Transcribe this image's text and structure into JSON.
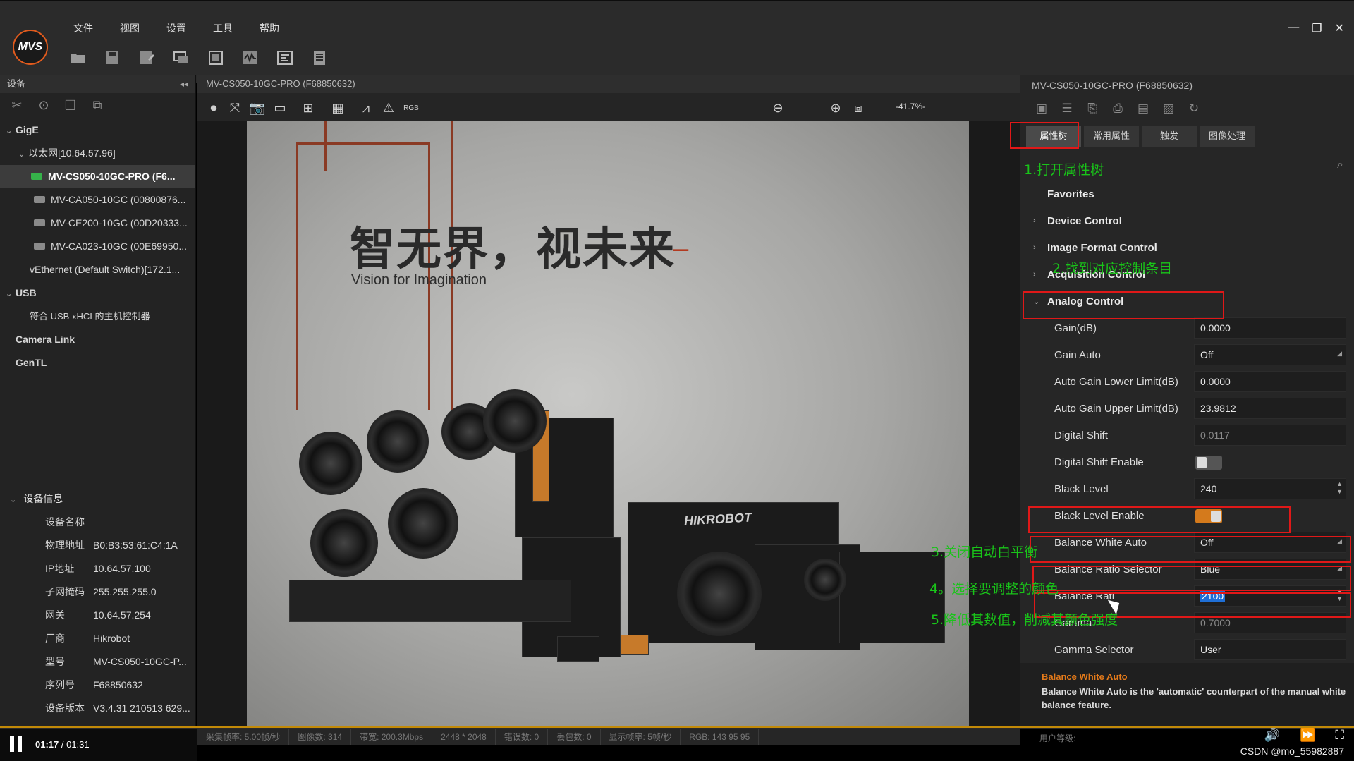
{
  "app": {
    "logo_text": "MVS",
    "menu": [
      "文件",
      "视图",
      "设置",
      "工具",
      "帮助"
    ],
    "window_controls": [
      "—",
      "❐",
      "✕"
    ]
  },
  "left_panel": {
    "header": "设备",
    "collapse": "◂◂",
    "tree": {
      "gige_label": "GigE",
      "ethernet": "以太网[10.64.57.96]",
      "devices": [
        "MV-CS050-10GC-PRO (F6...",
        "MV-CA050-10GC (00800876...",
        "MV-CE200-10GC (00D20333...",
        "MV-CA023-10GC (00E69950..."
      ],
      "vethernet": "vEthernet (Default Switch)[172.1...",
      "usb_label": "USB",
      "usb_controller": "符合 USB xHCI 的主机控制器",
      "camera_link": "Camera Link",
      "gentl": "GenTL"
    },
    "device_info": {
      "title": "设备信息",
      "rows": [
        {
          "k": "设备名称",
          "v": ""
        },
        {
          "k": "物理地址",
          "v": "B0:B3:53:61:C4:1A"
        },
        {
          "k": "IP地址",
          "v": "10.64.57.100"
        },
        {
          "k": "子网掩码",
          "v": "255.255.255.0"
        },
        {
          "k": "网关",
          "v": "10.64.57.254"
        },
        {
          "k": "厂商",
          "v": "Hikrobot"
        },
        {
          "k": "型号",
          "v": "MV-CS050-10GC-P..."
        },
        {
          "k": "序列号",
          "v": "F68850632"
        },
        {
          "k": "设备版本",
          "v": "V3.4.31 210513 629..."
        }
      ]
    }
  },
  "center": {
    "header": "MV-CS050-10GC-PRO (F68850632)",
    "zoom": "-41.7%-",
    "image": {
      "headline": "智无界，视未来",
      "dash": "–",
      "subline": "Vision for Imagination",
      "brand": "HIKROBOT"
    }
  },
  "right_panel": {
    "title": "MV-CS050-10GC-PRO (F68850632)",
    "tabs": [
      "属性树",
      "常用属性",
      "触发",
      "图像处理"
    ],
    "groups": {
      "favorites": "Favorites",
      "device_control": "Device Control",
      "image_format": "Image Format Control",
      "acquisition": "Acquisition Control",
      "analog": "Analog Control"
    },
    "props": [
      {
        "name": "Gain(dB)",
        "value": "0.0000"
      },
      {
        "name": "Gain Auto",
        "value": "Off"
      },
      {
        "name": "Auto Gain Lower Limit(dB)",
        "value": "0.0000"
      },
      {
        "name": "Auto Gain Upper Limit(dB)",
        "value": "23.9812"
      },
      {
        "name": "Digital Shift",
        "value": "0.0117"
      },
      {
        "name": "Digital Shift Enable",
        "value": ""
      },
      {
        "name": "Black Level",
        "value": "240"
      },
      {
        "name": "Black Level Enable",
        "value": ""
      },
      {
        "name": "Balance White Auto",
        "value": "Off"
      },
      {
        "name": "Balance Ratio Selector",
        "value": "Blue"
      },
      {
        "name": "Balance Rati",
        "value": "2100"
      },
      {
        "name": "Gamma",
        "value": "0.7000"
      },
      {
        "name": "Gamma Selector",
        "value": "User"
      }
    ],
    "description": {
      "title": "Balance White Auto",
      "text": "Balance White Auto is the 'automatic' counterpart of the manual white balance feature."
    }
  },
  "annotations": {
    "step1": "1.打开属性树",
    "step2": "2.找到对应控制条目",
    "step3": "3.关闭自动白平衡",
    "step4": "4。选择要调整的颜色",
    "step5": "5.降低其数值，削减其颜色强度"
  },
  "status_bar": {
    "items": [
      "采集帧率: 5.00帧/秒",
      "图像数: 314",
      "带宽: 200.3Mbps",
      "2448 * 2048",
      "错误数: 0",
      "丢包数: 0",
      "显示帧率: 5帧/秒",
      "RGB: 143 95 95"
    ],
    "user_level": "用户等级:"
  },
  "player": {
    "current": "01:17",
    "separator": " / ",
    "total": "01:31",
    "watermark": "CSDN @mo_55982887"
  },
  "colors": {
    "accent_orange": "#e47a1a",
    "annotation_green": "#19c419",
    "annotation_red": "#e01818",
    "selection_blue": "#1f6fd6"
  }
}
